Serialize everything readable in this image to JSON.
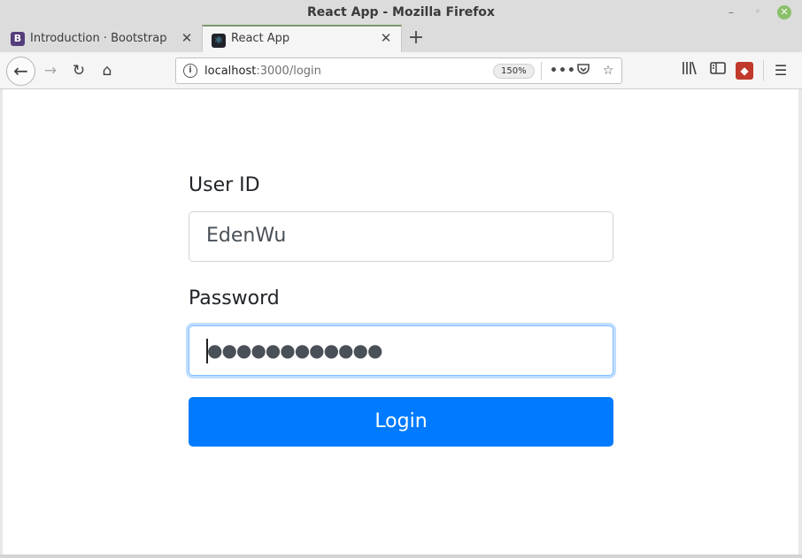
{
  "window": {
    "title": "React App - Mozilla Firefox"
  },
  "tabs": [
    {
      "icon": "B",
      "label": "Introduction · Bootstrap"
    },
    {
      "icon": "⚛",
      "label": "React App"
    }
  ],
  "urlbar": {
    "host": "localhost",
    "path": ":3000/login",
    "zoom": "150%"
  },
  "form": {
    "user_label": "User ID",
    "user_value": "EdenWu",
    "password_label": "Password",
    "password_value": "●●●●●●●●●●●●",
    "login_label": "Login"
  },
  "colors": {
    "primary": "#007bff",
    "focus_ring": "#80bdff"
  }
}
